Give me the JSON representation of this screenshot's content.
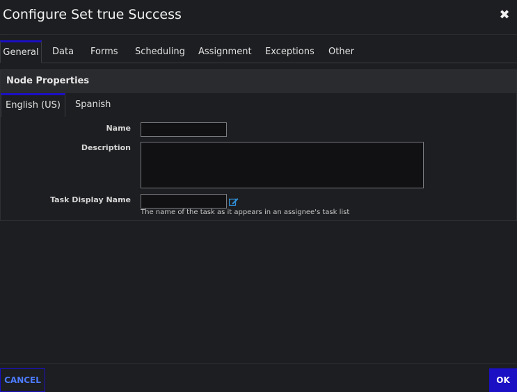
{
  "dialog": {
    "title": "Configure Set true Success",
    "close_icon": "close-icon"
  },
  "tabs": [
    {
      "label": "General",
      "active": true
    },
    {
      "label": "Data",
      "active": false
    },
    {
      "label": "Forms",
      "active": false
    },
    {
      "label": "Scheduling",
      "active": false
    },
    {
      "label": "Assignment",
      "active": false
    },
    {
      "label": "Exceptions",
      "active": false
    },
    {
      "label": "Other",
      "active": false
    }
  ],
  "node_properties": {
    "title": "Node Properties",
    "language_tabs": [
      {
        "label": "English (US)",
        "active": true
      },
      {
        "label": "Spanish",
        "active": false
      }
    ],
    "name": {
      "label": "Name",
      "value": ""
    },
    "description": {
      "label": "Description",
      "value": ""
    },
    "task_display_name": {
      "label": "Task Display Name",
      "value": "",
      "hint": "The name of the task as it appears in an assignee's task list",
      "edit_icon": "edit-icon"
    }
  },
  "footer": {
    "cancel_label": "CANCEL",
    "ok_label": "OK"
  },
  "colors": {
    "accent": "#1b10c4",
    "background": "#1d1e21",
    "section_header": "#2a2b2f",
    "input_bg": "#111113",
    "link": "#4c7bff"
  }
}
